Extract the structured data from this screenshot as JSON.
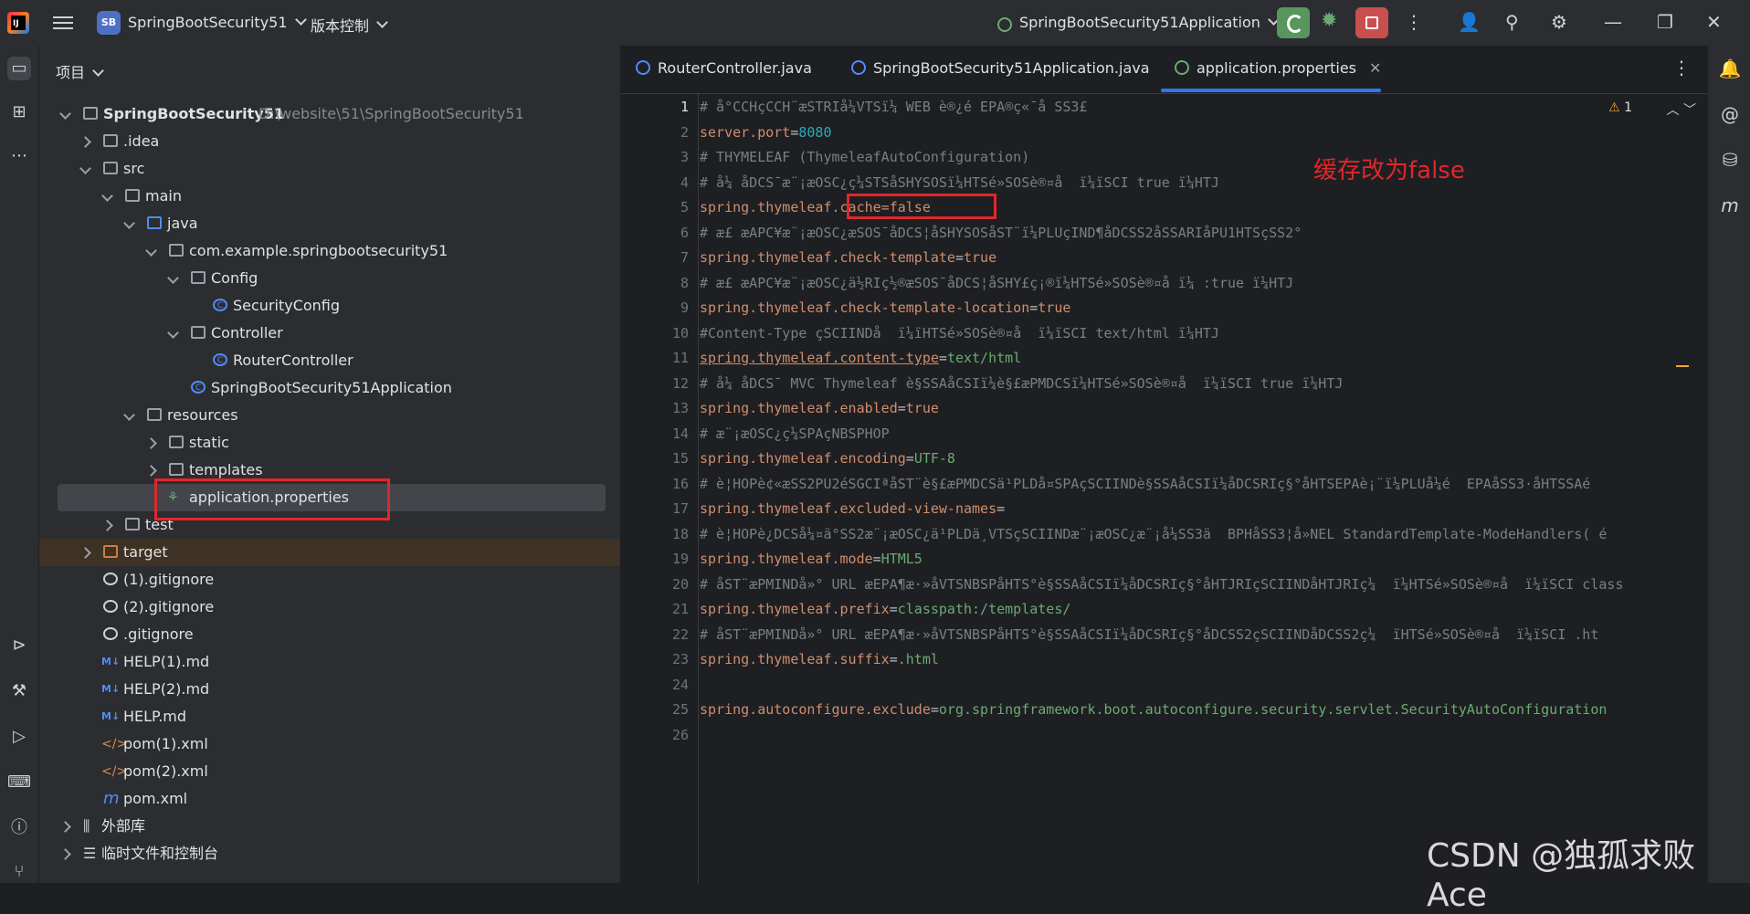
{
  "titlebar": {
    "badge": "SB",
    "project": "SpringBootSecurity51",
    "vcs": "版本控制",
    "run_config": "SpringBootSecurity51Application"
  },
  "panel": {
    "title": "项目"
  },
  "tree": {
    "root_name": "SpringBootSecurity51",
    "root_path": "D:\\website\\51\\SpringBootSecurity51",
    "idea": ".idea",
    "src": "src",
    "main": "main",
    "java": "java",
    "package": "com.example.springbootsecurity51",
    "config": "Config",
    "security_config": "SecurityConfig",
    "controller": "Controller",
    "router_controller": "RouterController",
    "app_class": "SpringBootSecurity51Application",
    "resources": "resources",
    "static": "static",
    "templates": "templates",
    "app_props": "application.properties",
    "test": "test",
    "target": "target",
    "gitignore1": "(1).gitignore",
    "gitignore2": "(2).gitignore",
    "gitignore": ".gitignore",
    "help1": "HELP(1).md",
    "help2": "HELP(2).md",
    "help": "HELP.md",
    "pom1": "pom(1).xml",
    "pom2": "pom(2).xml",
    "pom": "pom.xml",
    "external": "外部库",
    "scratches": "临时文件和控制台"
  },
  "tabs": {
    "t1": "RouterController.java",
    "t2": "SpringBootSecurity51Application.java",
    "t3": "application.properties"
  },
  "editor": {
    "warnings": "1",
    "lines": {
      "l1": "# å°CCHçCCH¨æSTRIå¼VTSï¼ WEB è®¿é EPA®ç«¯å SS3£",
      "l2k": "server.port",
      "l2v": "8080",
      "l3": "# THYMELEAF (ThymeleafAutoConfiguration)",
      "l4": "# å¼ åDCS¯æ¨¡æOSC¿ç¼STSåSHYSOSï¼HTSé»SOSè®¤å  ï¼ïSCI true ï¼HTJ",
      "l5k": "spring.thymeleaf.",
      "l5v": "cache=false",
      "l6": "# æ£ æAPC¥æ¨¡æOSC¿æSOS¯åDCS¦åSHYSOSåST¨ï¼PLUçIND¶åDCSS2åSSARIåPU1HTSçSS2°",
      "l7k": "spring.thymeleaf.check-template",
      "l7v": "true",
      "l8": "# æ£ æAPC¥æ¨¡æOSC¿ä½RIç½®æSOS¯åDCS¦åSHY£ç¡®ï¼HTSé»SOSè®¤å ï¼ :true ï¼HTJ",
      "l9k": "spring.thymeleaf.check-template-location",
      "l9v": "true",
      "l10": "#Content-Type çSCIINDå  ï¼ïHTSé»SOSè®¤å  ï¼ïSCI text/html ï¼HTJ",
      "l11k": "spring.thymeleaf.content-type",
      "l11v": "text/html",
      "l12": "# å¼ åDCS¯ MVC Thymeleaf è§SSAåCSIï¼è§£æPMDCSï¼HTSé»SOSè®¤å  ï¼ïSCI true ï¼HTJ",
      "l13k": "spring.thymeleaf.enabled",
      "l13v": "true",
      "l14": "# æ¨¡æOSC¿ç¼SPAçNBSPHOP",
      "l15k": "spring.thymeleaf.encoding",
      "l15v": "UTF-8",
      "l16": "# è¦HOPè¢«æSS2PU2éSGCIªåST¨è§£æPMDCSä¹PLDå¤SPAçSCIINDè§SSAåCSIï¼åDCSRIç§°åHTSEPAè¡¨ï¼PLUå¼é  EPAåSS3·åHTSSAé",
      "l17k": "spring.thymeleaf.excluded-view-names",
      "l17v": "",
      "l18": "# è¦HOPè¿DCSå¼¤ä°SS2æ¨¡æOSC¿ä¹PLDä¸VTSçSCIINDæ¨¡æOSC¿æ¨¡å¼SS3ä  BPHåSS3¦å»NEL StandardTemplate-ModeHandlers( é",
      "l19k": "spring.thymeleaf.mode",
      "l19v": "HTML5",
      "l20": "# åST¨æPMINDå»° URL æEPA¶æ·»åVTSNBSPåHTS°è§SSAåCSIï¼åDCSRIç§°åHTJRIçSCIINDåHTJRIç¼  ï¼HTSé»SOSè®¤å  ï¼ïSCI class",
      "l21k": "spring.thymeleaf.prefix",
      "l21v": "classpath:/templates/",
      "l22": "# åST¨æPMINDå»° URL æEPA¶æ·»åVTSNBSPåHTS°è§SSAåCSIï¼åDCSRIç§°åDCSS2çSCIINDåDCSS2ç¼  ïHTSé»SOSè®¤å  ï¼ïSCI .ht",
      "l23k": "spring.thymeleaf.suffix",
      "l23v": ".html",
      "l25k": "spring.autoconfigure.exclude",
      "l25v": "org.springframework.boot.autoconfigure.security.servlet.SecurityAutoConfiguration"
    }
  },
  "annotation": "缓存改为false",
  "watermark": "CSDN @独孤求败Ace",
  "colors": {
    "accent": "#3574f0",
    "annotation_red": "#e0272b",
    "run_green": "#57965c",
    "stop_red": "#c94f4f"
  }
}
